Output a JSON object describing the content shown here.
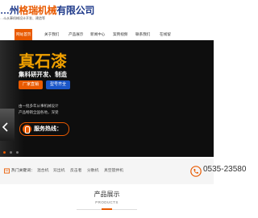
{
  "header": {
    "logo_prefix": "…州",
    "logo_highlight": "格瑞机械",
    "logo_suffix": "有限公司",
    "tagline": "…斗从事机械设计开发、建造等"
  },
  "nav": {
    "items": [
      "网站首页",
      "关于我们",
      "产品展示",
      "新闻中心",
      "案例视频",
      "联系我们",
      "在线留"
    ]
  },
  "banner": {
    "title": "真石漆",
    "subtitle": "集科研开发、制造",
    "btn_primary": "厂家直销",
    "btn_secondary": "型号齐全",
    "desc_lines": [
      "由一批多年从事机械设计",
      "产品畅销全国各地，深受"
    ],
    "hotline_label": "服务热线："
  },
  "strip": {
    "label": "热门关键词：",
    "keywords": [
      "混合机",
      "双出机",
      "反击者",
      "分散机",
      "真空搅拌机"
    ],
    "phone": "0535-23580"
  },
  "products": {
    "title": "产品展示",
    "subtitle": "PRODUCTS"
  },
  "colors": {
    "accent": "#e95a00",
    "brand_blue": "#1f3a8a",
    "banner_bg": "#0e0e0e"
  }
}
